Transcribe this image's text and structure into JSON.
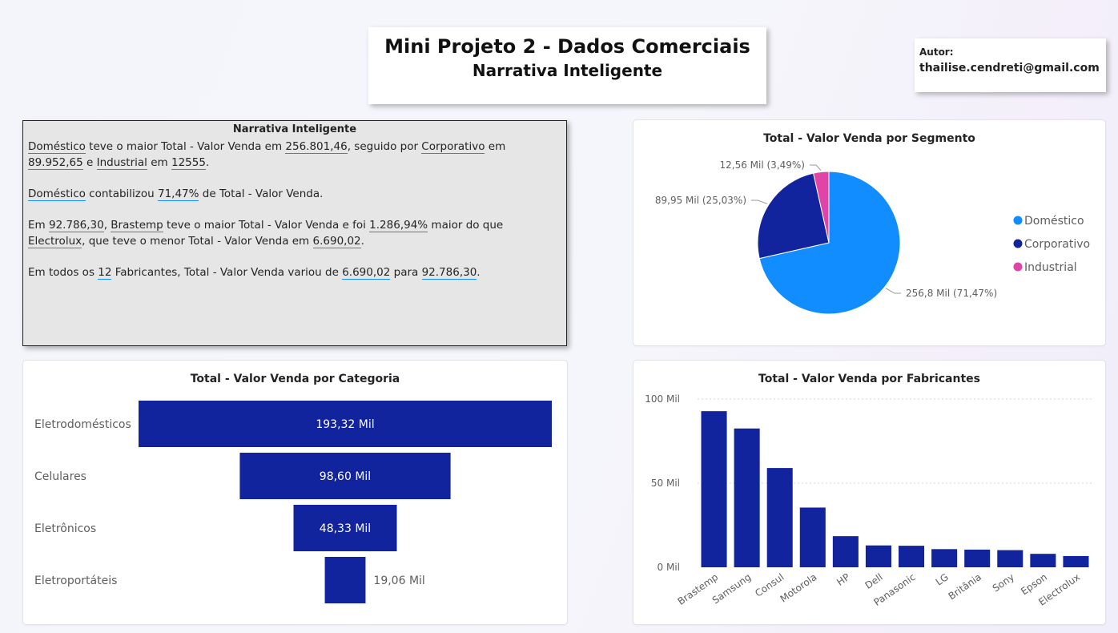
{
  "header": {
    "title": "Mini Projeto 2 - Dados Comerciais",
    "subtitle": "Narrativa Inteligente"
  },
  "author": {
    "label": "Autor:",
    "email": "thailise.cendreti@gmail.com"
  },
  "narrative": {
    "title": "Narrativa Inteligente",
    "p1": {
      "t1": "Doméstico",
      "t2": " teve o maior Total - Valor Venda em ",
      "t3": "256.801,46",
      "t4": ", seguido por ",
      "t5": "Corporativo",
      "t6": " em ",
      "t7": "89.952,65",
      "t8": " e ",
      "t9": "Industrial",
      "t10": " em ",
      "t11": "12555",
      "t12": "."
    },
    "p2": {
      "t1": "Doméstico",
      "t2": " contabilizou ",
      "t3": "71,47%",
      "t4": " de Total - Valor Venda."
    },
    "p3": {
      "t1": "Em ",
      "t2": "92.786,30",
      "t3": ", ",
      "t4": "Brastemp",
      "t5": " teve o maior Total - Valor Venda e foi ",
      "t6": "1.286,94%",
      "t7": " maior do que ",
      "t8": "Electrolux",
      "t9": ", que teve o menor Total - Valor Venda em ",
      "t10": "6.690,02",
      "t11": "."
    },
    "p4": {
      "t1": "Em todos os ",
      "t2": "12",
      "t3": " Fabricantes, Total - Valor Venda variou de ",
      "t4": "6.690,02",
      "t5": " para ",
      "t6": "92.786,30",
      "t7": "."
    }
  },
  "chart_data": [
    {
      "type": "pie",
      "title": "Total - Valor Venda por Segmento",
      "categories": [
        "Doméstico",
        "Corporativo",
        "Industrial"
      ],
      "values": [
        256.8,
        89.95,
        12.56
      ],
      "labels": [
        "256,8 Mil (71,47%)",
        "89,95 Mil (25,03%)",
        "12,56 Mil (3,49%)"
      ],
      "colors": [
        "#118dff",
        "#12239e",
        "#e044a7"
      ],
      "legend": "right"
    },
    {
      "type": "bar",
      "orientation": "funnel",
      "title": "Total - Valor Venda por Categoria",
      "categories": [
        "Eletrodomésticos",
        "Celulares",
        "Eletrônicos",
        "Eletroportáteis"
      ],
      "values": [
        193.32,
        98.6,
        48.33,
        19.06
      ],
      "labels": [
        "193,32 Mil",
        "98,60 Mil",
        "48,33 Mil",
        "19,06 Mil"
      ],
      "color": "#12239e"
    },
    {
      "type": "bar",
      "title": "Total - Valor Venda por Fabricantes",
      "categories": [
        "Brastemp",
        "Samsung",
        "Consul",
        "Motorola",
        "HP",
        "Dell",
        "Panasonic",
        "LG",
        "Britânia",
        "Sony",
        "Epson",
        "Electrolux"
      ],
      "values": [
        92.79,
        82.5,
        59.0,
        35.5,
        18.5,
        13.0,
        12.8,
        10.8,
        10.5,
        10.2,
        8.0,
        6.69
      ],
      "yticks": [
        "0 Mil",
        "50 Mil",
        "100 Mil"
      ],
      "ylim": [
        0,
        100
      ],
      "grid": true,
      "color": "#12239e"
    }
  ]
}
